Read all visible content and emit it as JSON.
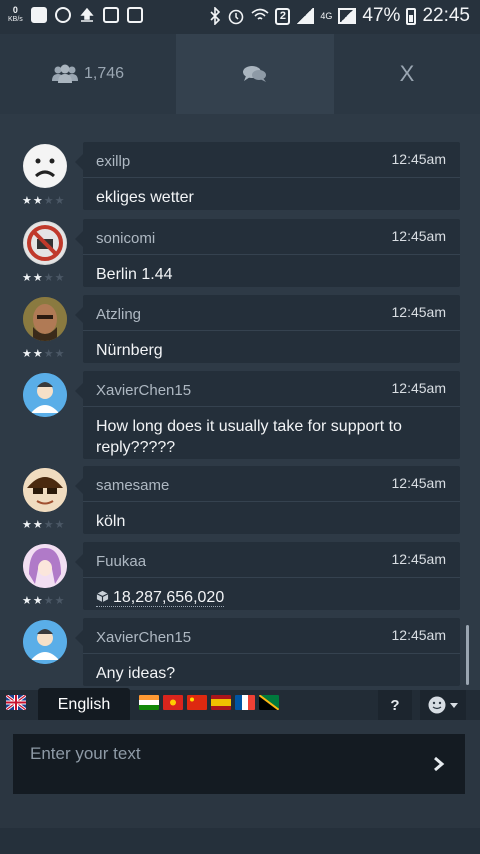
{
  "status_bar": {
    "speed_value": "0",
    "speed_unit": "KB/s",
    "network": "4G",
    "battery": "47%",
    "time": "22:45",
    "icons": [
      "z-app-icon",
      "at-icon",
      "upload-icon",
      "image-icon",
      "voicemail-icon",
      "bluetooth-icon",
      "alarm-icon",
      "wifi-icon",
      "sim-2-icon",
      "signal-icon",
      "battery-icon"
    ]
  },
  "tabs": {
    "users_count": "1,746",
    "close_label": "X",
    "icons": [
      "users-icon",
      "chat-icon"
    ]
  },
  "messages": [
    {
      "user": "exillp",
      "time": "12:45am",
      "text": "ekliges wetter",
      "stars": 2,
      "avatar": "sad-face"
    },
    {
      "user": "sonicomi",
      "time": "12:45am",
      "text": "Berlin 1.44",
      "stars": 2,
      "avatar": "no-sign"
    },
    {
      "user": "Atzling",
      "time": "12:45am",
      "text": "Nürnberg",
      "stars": 2,
      "avatar": "photo"
    },
    {
      "user": "XavierChen15",
      "time": "12:45am",
      "text": "How long does it usually take for support to reply?????",
      "stars": 0,
      "avatar": "default-user"
    },
    {
      "user": "samesame",
      "time": "12:45am",
      "text": "köln",
      "stars": 2,
      "avatar": "cartoon"
    },
    {
      "user": "Fuukaa",
      "time": "12:45am",
      "text": "18,287,656,020",
      "stars": 2,
      "avatar": "anime"
    },
    {
      "user": "XavierChen15",
      "time": "12:45am",
      "text": "Any ideas?",
      "stars": 0,
      "avatar": "default-user"
    }
  ],
  "language": {
    "tooltip": "English",
    "flags": [
      "uk",
      "india",
      "vietnam",
      "china",
      "spain",
      "france",
      "other"
    ]
  },
  "toolbar": {
    "help_label": "?"
  },
  "composer": {
    "placeholder": "Enter your text"
  },
  "colors": {
    "background": "#2e3a46",
    "bubble": "#242f3a",
    "input": "#141b22"
  }
}
